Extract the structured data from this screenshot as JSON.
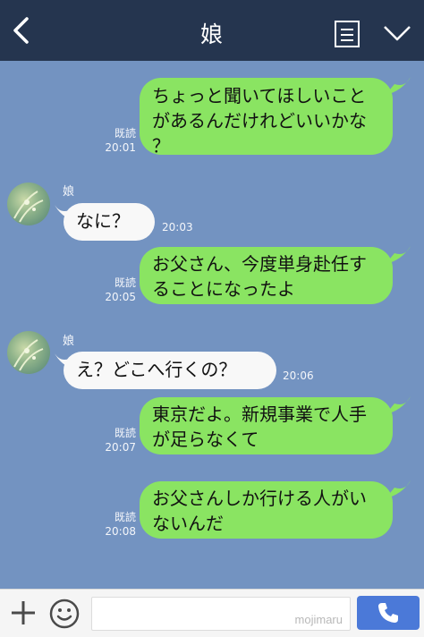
{
  "header": {
    "title": "娘",
    "back_icon": "chevron-left-icon",
    "menu_icon": "notes-icon",
    "dropdown_icon": "chevron-down-icon"
  },
  "messages": [
    {
      "side": "out",
      "text": "ちょっと聞いてほしいこと\nがあるんだけれどいいかな\n？",
      "read": "既読",
      "time": "20:01"
    },
    {
      "side": "in",
      "sender": "娘",
      "text": "なに？",
      "time": "20:03"
    },
    {
      "side": "out",
      "text": "お父さん、今度単身赴任す\nることになったよ",
      "read": "既読",
      "time": "20:05"
    },
    {
      "side": "in",
      "sender": "娘",
      "text": "え？どこへ行くの？",
      "time": "20:06"
    },
    {
      "side": "out",
      "text": "東京だよ。新規事業で人手\nが足らなくて",
      "read": "既読",
      "time": "20:07"
    },
    {
      "side": "out",
      "text": "お父さんしか行ける人がい\nないんだ",
      "read": "既読",
      "time": "20:08"
    }
  ],
  "footer": {
    "input_value": "",
    "watermark": "mojimaru",
    "plus_icon": "plus-icon",
    "emoji_icon": "smiley-icon",
    "call_icon": "phone-icon"
  },
  "colors": {
    "background": "#7393c1",
    "header": "#25354f",
    "outgoing_bubble": "#8ae462",
    "incoming_bubble": "#f8f8f8",
    "call_button": "#4b79d8"
  }
}
